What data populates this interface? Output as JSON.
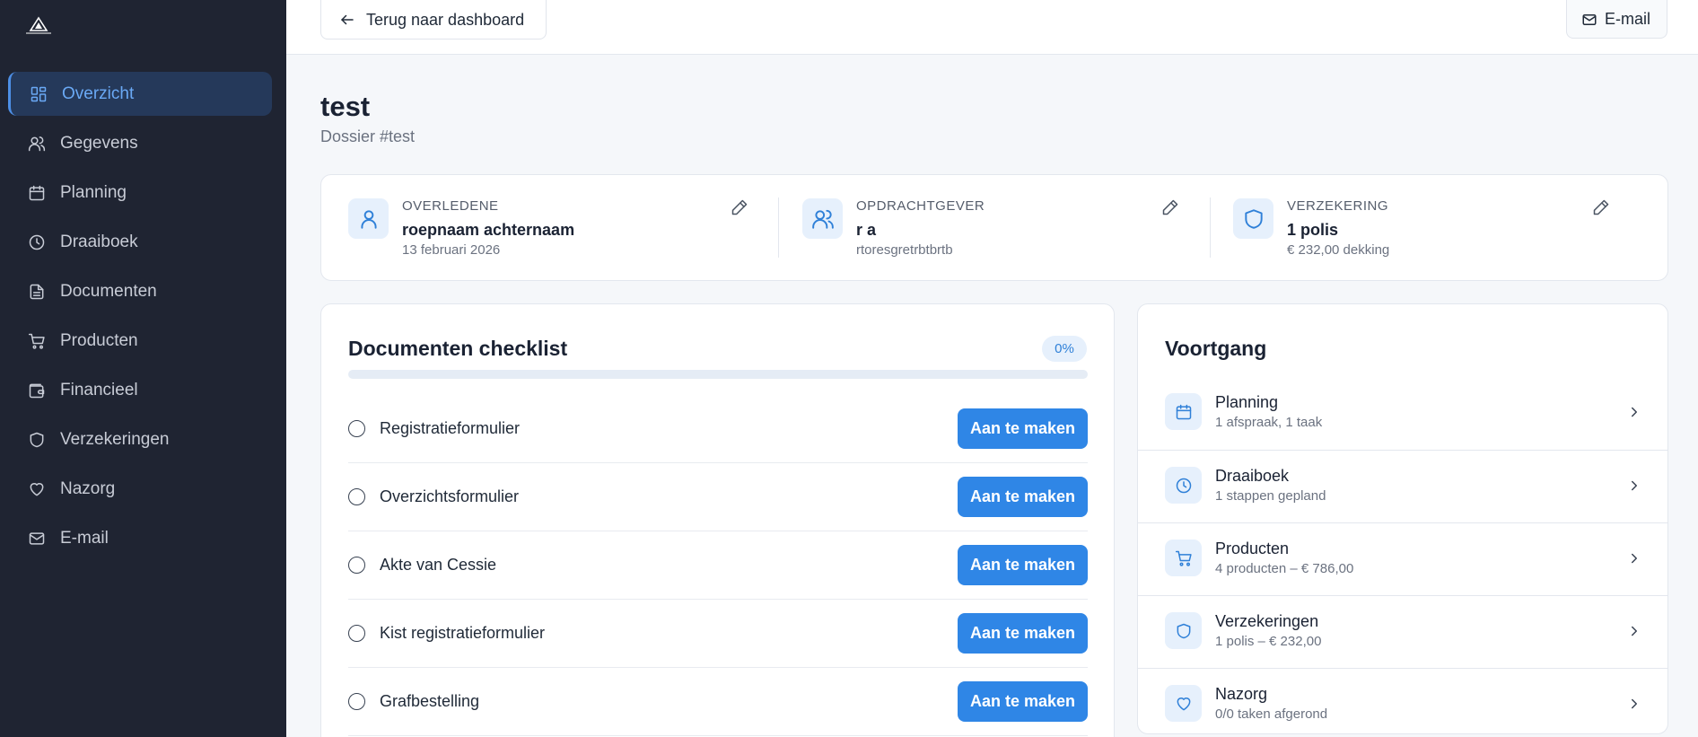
{
  "sidebar": {
    "logo_icon": "triangle-logo-icon",
    "items": [
      {
        "label": "Overzicht",
        "icon": "grid-icon",
        "active": true
      },
      {
        "label": "Gegevens",
        "icon": "users-icon",
        "active": false
      },
      {
        "label": "Planning",
        "icon": "calendar-icon",
        "active": false
      },
      {
        "label": "Draaiboek",
        "icon": "clock-icon",
        "active": false
      },
      {
        "label": "Documenten",
        "icon": "document-icon",
        "active": false
      },
      {
        "label": "Producten",
        "icon": "cart-icon",
        "active": false
      },
      {
        "label": "Financieel",
        "icon": "wallet-icon",
        "active": false
      },
      {
        "label": "Verzekeringen",
        "icon": "shield-icon",
        "active": false
      },
      {
        "label": "Nazorg",
        "icon": "heart-icon",
        "active": false
      },
      {
        "label": "E-mail",
        "icon": "mail-icon",
        "active": false
      }
    ]
  },
  "topbar": {
    "back_label": "Terug naar dashboard",
    "mail_label": "E-mail"
  },
  "page": {
    "title": "test",
    "subtitle": "Dossier #test"
  },
  "info": {
    "deceased": {
      "label": "OVERLEDENE",
      "value": "roepnaam achternaam",
      "meta": "13 februari 2026"
    },
    "client": {
      "label": "OPDRACHTGEVER",
      "value": "r a",
      "meta": "rtoresgretrbtbrtb"
    },
    "insurance": {
      "label": "VERZEKERING",
      "value": "1 polis",
      "meta": "€ 232,00 dekking"
    }
  },
  "checklist": {
    "title": "Documenten checklist",
    "percent_label": "0%",
    "progress": 0,
    "items": [
      {
        "name": "Registratieformulier",
        "action": "Aan te maken"
      },
      {
        "name": "Overzichtsformulier",
        "action": "Aan te maken"
      },
      {
        "name": "Akte van Cessie",
        "action": "Aan te maken"
      },
      {
        "name": "Kist registratieformulier",
        "action": "Aan te maken"
      },
      {
        "name": "Grafbestelling",
        "action": "Aan te maken"
      }
    ]
  },
  "voortgang": {
    "title": "Voortgang",
    "items": [
      {
        "name": "Planning",
        "meta": "1 afspraak, 1 taak",
        "icon": "calendar-icon"
      },
      {
        "name": "Draaiboek",
        "meta": "1 stappen gepland",
        "icon": "clock-icon"
      },
      {
        "name": "Producten",
        "meta": "4 producten – € 786,00",
        "icon": "cart-icon"
      },
      {
        "name": "Verzekeringen",
        "meta": "1 polis – € 232,00",
        "icon": "shield-icon"
      },
      {
        "name": "Nazorg",
        "meta": "0/0 taken afgerond",
        "icon": "heart-icon"
      }
    ]
  },
  "colors": {
    "sidebar_bg": "#1f2432",
    "accent": "#2f86e6",
    "active_nav_text": "#6aa9f5"
  }
}
